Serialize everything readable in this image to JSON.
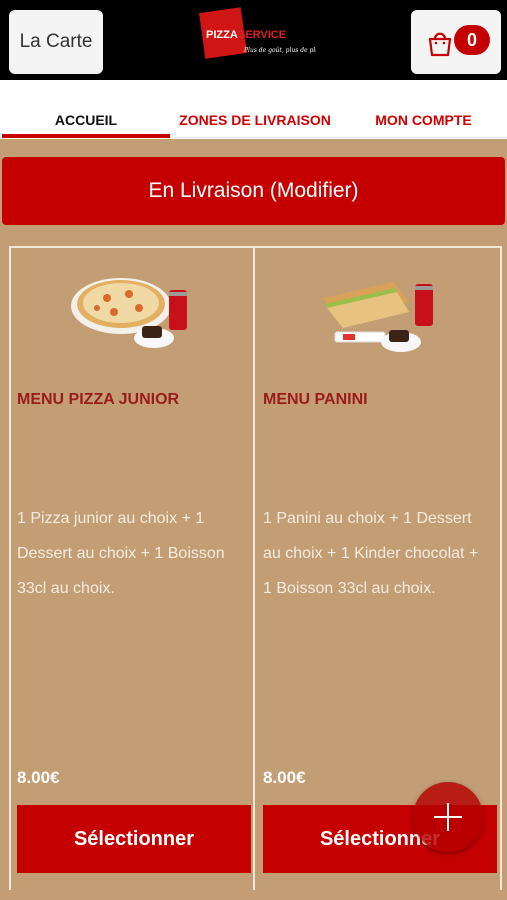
{
  "header": {
    "menu_button_label": "La Carte",
    "logo_text": "PIZZA SERVICE",
    "logo_tagline": "Plus de goût, plus de plaisir!",
    "cart_count": "0",
    "cart_icon": "shopping-bag-icon"
  },
  "tabs": [
    {
      "label": "ACCUEIL",
      "active": true
    },
    {
      "label": "ZONES DE LIVRAISON",
      "active": false
    },
    {
      "label": "MON COMPTE",
      "active": false
    }
  ],
  "banner": {
    "label": "En Livraison (Modifier)"
  },
  "products": [
    {
      "title": "MENU PIZZA JUNIOR",
      "description": "1 Pizza junior au choix  + 1 Dessert au choix  + 1 Boisson 33cl au choix.",
      "price": "8.00€",
      "button_label": "Sélectionner",
      "image_icon": "pizza-menu-icon"
    },
    {
      "title": "MENU PANINI",
      "description": "1 Panini au choix  + 1 Dessert au choix  + 1 Kinder chocolat  + 1 Boisson 33cl au choix.",
      "price": "8.00€",
      "button_label": "Sélectionner",
      "image_icon": "panini-menu-icon"
    }
  ],
  "fab": {
    "icon": "plus-icon"
  },
  "colors": {
    "brand_red": "#c50000",
    "background_tan": "#c39e75",
    "title_dark_red": "#9b1b1b"
  }
}
